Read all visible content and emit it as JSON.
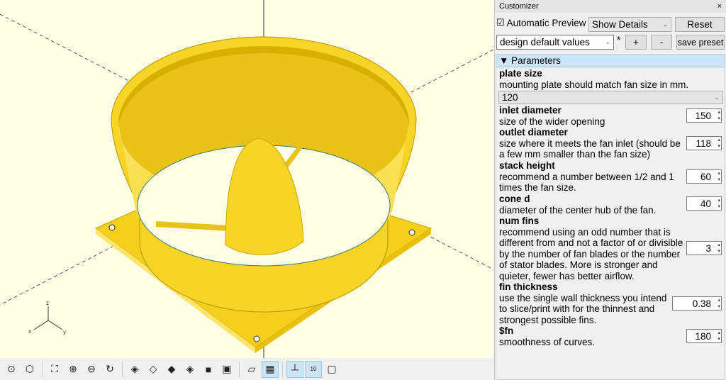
{
  "customizer": {
    "title": "Customizer",
    "close": "×",
    "auto_preview_label": "Automatic Preview",
    "auto_preview_checked": true,
    "details_select": "Show Details",
    "reset": "Reset",
    "preset_select": "design default values",
    "preset_modified": "*",
    "add": "+",
    "remove": "-",
    "save_preset": "save preset",
    "section": "Parameters",
    "params": [
      {
        "name": "plate size",
        "desc": "mounting plate should match fan size in mm.",
        "value": "120",
        "type": "select"
      },
      {
        "name": "inlet diameter",
        "desc": "size of the wider opening",
        "value": "150"
      },
      {
        "name": "outlet diameter",
        "desc": "size where it meets the fan inlet (should be a few mm smaller than the fan size)",
        "value": "118"
      },
      {
        "name": "stack height",
        "desc": "recommend a number between 1/2 and 1 times the fan size.",
        "value": "60"
      },
      {
        "name": "cone d",
        "desc": "diameter of the center hub of the fan.",
        "value": "40"
      },
      {
        "name": "num fins",
        "desc": "recommend using an odd number that is different from and not a factor of or divisible by the number of fan blades or the number of stator blades. More is stronger and quieter, fewer has better airflow.",
        "value": "3"
      },
      {
        "name": "fin thickness",
        "desc": "use the single wall thickness you intend to slice/print with for the thinnest and strongest possible fins.",
        "value": "0.38"
      },
      {
        "name": "$fn",
        "desc": "smoothness of curves.",
        "value": "180"
      }
    ]
  },
  "axes": {
    "x": "x",
    "y": "y",
    "z": "z",
    "scale_label": "10"
  },
  "colors": {
    "model": "#f9d72f",
    "viewport": "#ffffe5"
  }
}
